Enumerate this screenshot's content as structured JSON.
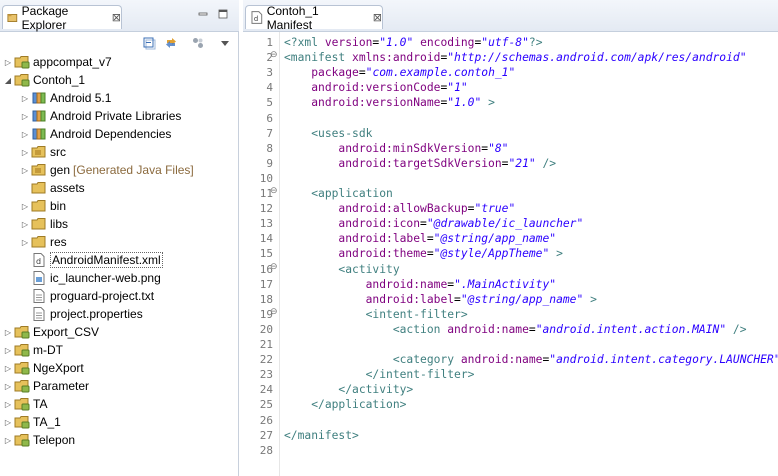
{
  "package_explorer": {
    "tab_label": "Package Explorer",
    "close_glyph": "⊠",
    "toolbar": [
      "collapse-all-icon",
      "link-with-editor-icon",
      "view-menu-icon"
    ],
    "tree": [
      {
        "label": "appcompat_v7",
        "expanded": false,
        "icon": "project-icon",
        "level": 0
      },
      {
        "label": "Contoh_1",
        "expanded": true,
        "icon": "project-icon",
        "level": 0
      },
      {
        "label": "Android 5.1",
        "expanded": false,
        "icon": "library-icon",
        "level": 1
      },
      {
        "label": "Android Private Libraries",
        "expanded": false,
        "icon": "library-icon",
        "level": 1
      },
      {
        "label": "Android Dependencies",
        "expanded": false,
        "icon": "library-icon",
        "level": 1
      },
      {
        "label": "src",
        "expanded": false,
        "icon": "source-folder-icon",
        "level": 1
      },
      {
        "label": "gen",
        "decoration": "[Generated Java Files]",
        "expanded": false,
        "icon": "source-folder-icon",
        "level": 1
      },
      {
        "label": "assets",
        "expanded": null,
        "icon": "folder-icon",
        "level": 1
      },
      {
        "label": "bin",
        "expanded": false,
        "icon": "folder-icon",
        "level": 1
      },
      {
        "label": "libs",
        "expanded": false,
        "icon": "folder-icon",
        "level": 1
      },
      {
        "label": "res",
        "expanded": false,
        "icon": "folder-icon",
        "level": 1
      },
      {
        "label": "AndroidManifest.xml",
        "expanded": null,
        "icon": "xml-file-icon",
        "level": 1,
        "selected": true
      },
      {
        "label": "ic_launcher-web.png",
        "expanded": null,
        "icon": "image-file-icon",
        "level": 1
      },
      {
        "label": "proguard-project.txt",
        "expanded": null,
        "icon": "text-file-icon",
        "level": 1
      },
      {
        "label": "project.properties",
        "expanded": null,
        "icon": "text-file-icon",
        "level": 1
      },
      {
        "label": "Export_CSV",
        "expanded": false,
        "icon": "project-icon",
        "level": 0
      },
      {
        "label": "m-DT",
        "expanded": false,
        "icon": "project-icon",
        "level": 0
      },
      {
        "label": "NgeXport",
        "expanded": false,
        "icon": "project-icon",
        "level": 0
      },
      {
        "label": "Parameter",
        "expanded": false,
        "icon": "project-icon",
        "level": 0
      },
      {
        "label": "TA",
        "expanded": false,
        "icon": "project-icon",
        "level": 0
      },
      {
        "label": "TA_1",
        "expanded": false,
        "icon": "project-icon",
        "level": 0
      },
      {
        "label": "Telepon",
        "expanded": false,
        "icon": "project-icon",
        "level": 0
      }
    ]
  },
  "editor": {
    "tab_label": "Contoh_1 Manifest",
    "close_glyph": "⊠",
    "lines": [
      {
        "n": "1",
        "fold": "",
        "segs": [
          [
            "pi",
            "<?xml "
          ],
          [
            "attr",
            "version"
          ],
          [
            "pun",
            "="
          ],
          [
            "val",
            "\"1.0\""
          ],
          [
            "pun",
            " "
          ],
          [
            "attr",
            "encoding"
          ],
          [
            "pun",
            "="
          ],
          [
            "val",
            "\"utf-8\""
          ],
          [
            "pi",
            "?>"
          ]
        ]
      },
      {
        "n": "2",
        "fold": "⊖",
        "segs": [
          [
            "tag",
            "<manifest "
          ],
          [
            "attr",
            "xmlns:android"
          ],
          [
            "pun",
            "="
          ],
          [
            "val",
            "\"http://schemas.android.com/apk/res/android\""
          ]
        ]
      },
      {
        "n": "3",
        "fold": "",
        "segs": [
          [
            "pun",
            "    "
          ],
          [
            "attr",
            "package"
          ],
          [
            "pun",
            "="
          ],
          [
            "val",
            "\"com.example.contoh_1\""
          ]
        ]
      },
      {
        "n": "4",
        "fold": "",
        "segs": [
          [
            "pun",
            "    "
          ],
          [
            "attr",
            "android:versionCode"
          ],
          [
            "pun",
            "="
          ],
          [
            "val",
            "\"1\""
          ]
        ]
      },
      {
        "n": "5",
        "fold": "",
        "segs": [
          [
            "pun",
            "    "
          ],
          [
            "attr",
            "android:versionName"
          ],
          [
            "pun",
            "="
          ],
          [
            "val",
            "\"1.0\""
          ],
          [
            "tag",
            " >"
          ]
        ]
      },
      {
        "n": "6",
        "fold": "",
        "segs": []
      },
      {
        "n": "7",
        "fold": "",
        "segs": [
          [
            "pun",
            "    "
          ],
          [
            "tag",
            "<uses-sdk"
          ]
        ]
      },
      {
        "n": "8",
        "fold": "",
        "segs": [
          [
            "pun",
            "        "
          ],
          [
            "attr",
            "android:minSdkVersion"
          ],
          [
            "pun",
            "="
          ],
          [
            "val",
            "\"8\""
          ]
        ]
      },
      {
        "n": "9",
        "fold": "",
        "segs": [
          [
            "pun",
            "        "
          ],
          [
            "attr",
            "android:targetSdkVersion"
          ],
          [
            "pun",
            "="
          ],
          [
            "val",
            "\"21\""
          ],
          [
            "tag",
            " />"
          ]
        ]
      },
      {
        "n": "10",
        "fold": "",
        "segs": []
      },
      {
        "n": "11",
        "fold": "⊖",
        "segs": [
          [
            "pun",
            "    "
          ],
          [
            "tag",
            "<application"
          ]
        ]
      },
      {
        "n": "12",
        "fold": "",
        "segs": [
          [
            "pun",
            "        "
          ],
          [
            "attr",
            "android:allowBackup"
          ],
          [
            "pun",
            "="
          ],
          [
            "val",
            "\"true\""
          ]
        ]
      },
      {
        "n": "13",
        "fold": "",
        "segs": [
          [
            "pun",
            "        "
          ],
          [
            "attr",
            "android:icon"
          ],
          [
            "pun",
            "="
          ],
          [
            "val",
            "\"@drawable/ic_launcher\""
          ]
        ]
      },
      {
        "n": "14",
        "fold": "",
        "segs": [
          [
            "pun",
            "        "
          ],
          [
            "attr",
            "android:label"
          ],
          [
            "pun",
            "="
          ],
          [
            "val",
            "\"@string/app_name\""
          ]
        ]
      },
      {
        "n": "15",
        "fold": "",
        "segs": [
          [
            "pun",
            "        "
          ],
          [
            "attr",
            "android:theme"
          ],
          [
            "pun",
            "="
          ],
          [
            "val",
            "\"@style/AppTheme\""
          ],
          [
            "tag",
            " >"
          ]
        ]
      },
      {
        "n": "16",
        "fold": "⊖",
        "segs": [
          [
            "pun",
            "        "
          ],
          [
            "tag",
            "<activity"
          ]
        ]
      },
      {
        "n": "17",
        "fold": "",
        "segs": [
          [
            "pun",
            "            "
          ],
          [
            "attr",
            "android:name"
          ],
          [
            "pun",
            "="
          ],
          [
            "val",
            "\".MainActivity\""
          ]
        ]
      },
      {
        "n": "18",
        "fold": "",
        "segs": [
          [
            "pun",
            "            "
          ],
          [
            "attr",
            "android:label"
          ],
          [
            "pun",
            "="
          ],
          [
            "val",
            "\"@string/app_name\""
          ],
          [
            "tag",
            " >"
          ]
        ]
      },
      {
        "n": "19",
        "fold": "⊖",
        "segs": [
          [
            "pun",
            "            "
          ],
          [
            "tag",
            "<intent-filter>"
          ]
        ]
      },
      {
        "n": "20",
        "fold": "",
        "segs": [
          [
            "pun",
            "                "
          ],
          [
            "tag",
            "<action "
          ],
          [
            "attr",
            "android:name"
          ],
          [
            "pun",
            "="
          ],
          [
            "val",
            "\"android.intent.action.MAIN\""
          ],
          [
            "tag",
            " />"
          ]
        ]
      },
      {
        "n": "21",
        "fold": "",
        "segs": []
      },
      {
        "n": "22",
        "fold": "",
        "segs": [
          [
            "pun",
            "                "
          ],
          [
            "tag",
            "<category "
          ],
          [
            "attr",
            "android:name"
          ],
          [
            "pun",
            "="
          ],
          [
            "val",
            "\"android.intent.category.LAUNCHER\""
          ],
          [
            "tag",
            " />"
          ]
        ]
      },
      {
        "n": "23",
        "fold": "",
        "segs": [
          [
            "pun",
            "            "
          ],
          [
            "tag",
            "</intent-filter>"
          ]
        ]
      },
      {
        "n": "24",
        "fold": "",
        "segs": [
          [
            "pun",
            "        "
          ],
          [
            "tag",
            "</activity>"
          ]
        ]
      },
      {
        "n": "25",
        "fold": "",
        "segs": [
          [
            "pun",
            "    "
          ],
          [
            "tag",
            "</application>"
          ]
        ]
      },
      {
        "n": "26",
        "fold": "",
        "segs": []
      },
      {
        "n": "27",
        "fold": "",
        "segs": [
          [
            "tag",
            "</manifest>"
          ]
        ]
      },
      {
        "n": "28",
        "fold": "",
        "segs": []
      }
    ]
  }
}
